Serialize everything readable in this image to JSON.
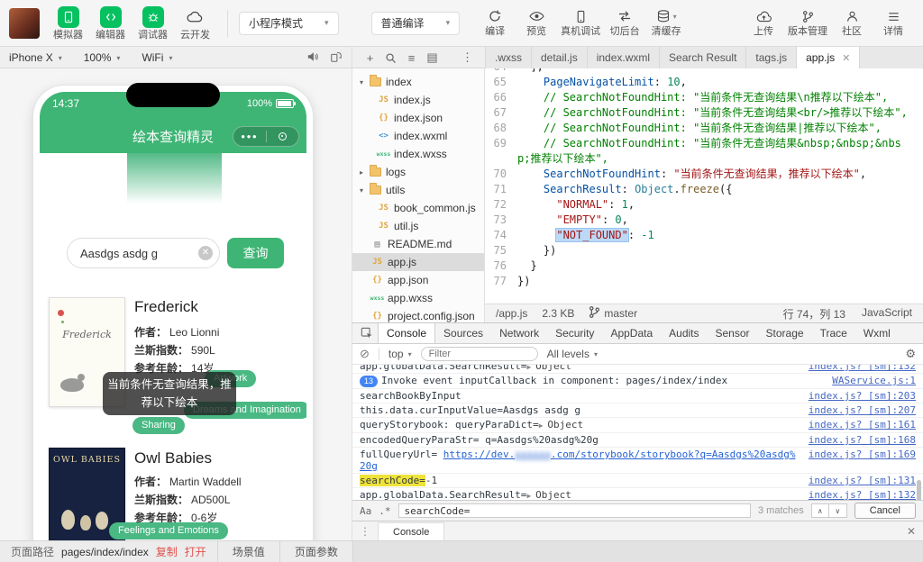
{
  "toolbar": {
    "panel_toggles": [
      {
        "id": "simulator",
        "label": "模拟器",
        "icon": "simulator-icon"
      },
      {
        "id": "editor",
        "label": "编辑器",
        "icon": "code-editor-icon"
      },
      {
        "id": "debugger",
        "label": "调试器",
        "icon": "debugger-icon"
      },
      {
        "id": "cloud-dev",
        "label": "云开发",
        "icon": "cloud-icon",
        "plain": true
      }
    ],
    "mode_select": "小程序模式",
    "compile_select": "普通编译",
    "actions": [
      {
        "id": "compile",
        "label": "编译",
        "icon": "compile-icon"
      },
      {
        "id": "preview",
        "label": "预览",
        "icon": "preview-eye-icon"
      },
      {
        "id": "real-device-debug",
        "label": "真机调试",
        "icon": "real-device-icon"
      },
      {
        "id": "switch-background",
        "label": "切后台",
        "icon": "switch-background-icon"
      },
      {
        "id": "clear-cache",
        "label": "清缓存",
        "icon": "clear-cache-icon",
        "caret": true
      }
    ],
    "right_actions": [
      {
        "id": "upload",
        "label": "上传",
        "icon": "upload-icon"
      },
      {
        "id": "version-manage",
        "label": "版本管理",
        "icon": "version-branch-icon"
      },
      {
        "id": "community",
        "label": "社区",
        "icon": "community-icon"
      },
      {
        "id": "details",
        "label": "详情",
        "icon": "details-menu-icon"
      }
    ]
  },
  "device_bar": {
    "device": "iPhone X",
    "zoom": "100%",
    "network": "WiFi",
    "icons": [
      "speaker-icon",
      "rotate-device-icon"
    ]
  },
  "tree_tools": {
    "icons": [
      "new-file-icon",
      "search-icon",
      "file-list-icon",
      "split-view-icon",
      "more-icon"
    ],
    "glyphs": [
      "+",
      "",
      "≡",
      "▤",
      "⋮"
    ]
  },
  "simulator": {
    "status_time": "14:37",
    "battery": "100%",
    "nav_title": "绘本查询精灵",
    "search_value": "Aasdgs asdg g",
    "search_button": "查询",
    "toast": "当前条件无查询结果，推荐以下绘本",
    "books": [
      {
        "title": "Frederick",
        "cover_text": "Frederick",
        "fields": [
          {
            "label": "作者：",
            "value": "Leo Lionni"
          },
          {
            "label": "兰斯指数：",
            "value": "590L"
          },
          {
            "label": "参考年龄：",
            "value": "14岁"
          }
        ],
        "tags": [
          "Artwork",
          "Dreams and Imagination",
          "Sharing"
        ]
      },
      {
        "title": "Owl Babies",
        "cover_text": "OWL BABIES",
        "fields": [
          {
            "label": "作者：",
            "value": "Martin Waddell"
          },
          {
            "label": "兰斯指数：",
            "value": "AD500L"
          },
          {
            "label": "参考年龄：",
            "value": "0-6岁"
          }
        ],
        "tags": [
          "Feelings and Emotions"
        ]
      }
    ]
  },
  "file_tree": {
    "items": [
      {
        "label": "index",
        "type": "folder",
        "expanded": true,
        "depth": 0
      },
      {
        "label": "index.js",
        "type": "js",
        "depth": 1
      },
      {
        "label": "index.json",
        "type": "json",
        "depth": 1
      },
      {
        "label": "index.wxml",
        "type": "wxml",
        "depth": 1
      },
      {
        "label": "index.wxss",
        "type": "wxss",
        "depth": 1
      },
      {
        "label": "logs",
        "type": "folder",
        "expanded": false,
        "depth": 0
      },
      {
        "label": "utils",
        "type": "folder",
        "expanded": true,
        "depth": 0
      },
      {
        "label": "book_common.js",
        "type": "js",
        "depth": 1
      },
      {
        "label": "util.js",
        "type": "js",
        "depth": 1
      },
      {
        "label": "README.md",
        "type": "md",
        "depth": 0
      },
      {
        "label": "app.js",
        "type": "js",
        "depth": 0,
        "selected": true
      },
      {
        "label": "app.json",
        "type": "json",
        "depth": 0
      },
      {
        "label": "app.wxss",
        "type": "wxss",
        "depth": 0
      },
      {
        "label": "project.config.json",
        "type": "json",
        "depth": 0
      }
    ]
  },
  "editor": {
    "tabs": [
      {
        "label": ".wxss"
      },
      {
        "label": "detail.js"
      },
      {
        "label": "index.wxml"
      },
      {
        "label": "Search Result"
      },
      {
        "label": "tags.js"
      },
      {
        "label": "app.js",
        "active": true,
        "closable": true
      }
    ],
    "lines": [
      {
        "n": "64",
        "segs": [
          {
            "t": "  ],"
          }
        ]
      },
      {
        "n": "65",
        "segs": [
          {
            "t": "    "
          },
          {
            "t": "PageNavigateLimit",
            "c": "prop"
          },
          {
            "t": ": "
          },
          {
            "t": "10",
            "c": "num"
          },
          {
            "t": ","
          }
        ]
      },
      {
        "n": "66",
        "segs": [
          {
            "t": "    "
          },
          {
            "t": "// SearchNotFoundHint: \"当前条件无查询结果\\n推荐以下绘本\",",
            "c": "com"
          }
        ]
      },
      {
        "n": "67",
        "segs": [
          {
            "t": "    "
          },
          {
            "t": "// SearchNotFoundHint: \"当前条件无查询结果<br/>推荐以下绘本\",",
            "c": "com"
          }
        ]
      },
      {
        "n": "68",
        "segs": [
          {
            "t": "    "
          },
          {
            "t": "// SearchNotFoundHint: \"当前条件无查询结果|推荐以下绘本\",",
            "c": "com"
          }
        ]
      },
      {
        "n": "69",
        "segs": [
          {
            "t": "    "
          },
          {
            "t": "// SearchNotFoundHint: \"当前条件无查询结果&nbsp;&nbsp;&nbsp;推荐以下绘本\",",
            "c": "com"
          }
        ]
      },
      {
        "n": "70",
        "segs": [
          {
            "t": "    "
          },
          {
            "t": "SearchNotFoundHint",
            "c": "prop"
          },
          {
            "t": ": "
          },
          {
            "t": "\"当前条件无查询结果，推荐以下绘本\"",
            "c": "str"
          },
          {
            "t": ","
          }
        ]
      },
      {
        "n": "71",
        "segs": [
          {
            "t": "    "
          },
          {
            "t": "SearchResult",
            "c": "prop"
          },
          {
            "t": ": "
          },
          {
            "t": "Object",
            "c": "cls"
          },
          {
            "t": "."
          },
          {
            "t": "freeze",
            "c": "meth"
          },
          {
            "t": "({"
          }
        ]
      },
      {
        "n": "72",
        "segs": [
          {
            "t": "      "
          },
          {
            "t": "\"NORMAL\"",
            "c": "str"
          },
          {
            "t": ": "
          },
          {
            "t": "1",
            "c": "num"
          },
          {
            "t": ","
          }
        ]
      },
      {
        "n": "73",
        "segs": [
          {
            "t": "      "
          },
          {
            "t": "\"EMPTY\"",
            "c": "str"
          },
          {
            "t": ": "
          },
          {
            "t": "0",
            "c": "num"
          },
          {
            "t": ","
          }
        ]
      },
      {
        "n": "74",
        "segs": [
          {
            "t": "      "
          },
          {
            "t": "\"NOT_FOUND\"",
            "c": "str sel"
          },
          {
            "t": ": "
          },
          {
            "t": "-1",
            "c": "num"
          }
        ]
      },
      {
        "n": "75",
        "segs": [
          {
            "t": "    })"
          }
        ]
      },
      {
        "n": "76",
        "segs": [
          {
            "t": "  }"
          }
        ]
      },
      {
        "n": "77",
        "segs": [
          {
            "t": "})"
          }
        ]
      }
    ],
    "status_left": {
      "file": "/app.js",
      "size": "2.3 KB",
      "branch": "master"
    },
    "status_right": {
      "cursor": "行 74，列 13",
      "language": "JavaScript"
    }
  },
  "devtools": {
    "tabs": [
      {
        "label": "Console",
        "active": true
      },
      {
        "label": "Sources"
      },
      {
        "label": "Network"
      },
      {
        "label": "Security"
      },
      {
        "label": "AppData"
      },
      {
        "label": "Audits"
      },
      {
        "label": "Sensor"
      },
      {
        "label": "Storage"
      },
      {
        "label": "Trace"
      },
      {
        "label": "Wxml"
      }
    ],
    "filter_bar": {
      "context": "top",
      "filter_placeholder": "Filter",
      "levels": "All levels"
    },
    "rows": [
      {
        "clipped": true,
        "parts": [
          {
            "t": "app.globalData.SearchResult="
          },
          {
            "t": "▶ ",
            "c": "arrow"
          },
          {
            "t": "Object",
            "c": "obj"
          }
        ],
        "link": "index.js? [sm]:132"
      },
      {
        "badge": "13",
        "parts": [
          {
            "t": "Invoke event inputCallback in component: pages/index/index"
          }
        ],
        "link": "WAService.js:1"
      },
      {
        "parts": [
          {
            "t": "searchBookByInput"
          }
        ],
        "link": "index.js? [sm]:203"
      },
      {
        "parts": [
          {
            "t": "this.data.curInputValue=Aasdgs asdg g"
          }
        ],
        "link": "index.js? [sm]:207"
      },
      {
        "parts": [
          {
            "t": "queryStorybook: queryParaDict="
          },
          {
            "t": "▶ ",
            "c": "arrow"
          },
          {
            "t": "Object",
            "c": "obj"
          }
        ],
        "link": "index.js? [sm]:161"
      },
      {
        "parts": [
          {
            "t": "encodedQueryParaStr= q=Aasdgs%20asdg%20g"
          }
        ],
        "link": "index.js? [sm]:168"
      },
      {
        "parts": [
          {
            "t": "fullQueryUrl= "
          },
          {
            "t": "https://dev.",
            "c": "url"
          },
          {
            "t": "xxxxxx",
            "c": "url redact"
          },
          {
            "t": ".com/storybook/storybook?q=Aasdgs%20asdg%20g",
            "c": "url"
          }
        ],
        "link": "index.js? [sm]:169"
      },
      {
        "parts": [
          {
            "t": "searchCode=",
            "c": "hl"
          },
          {
            "t": "-1"
          }
        ],
        "link": "index.js? [sm]:131"
      },
      {
        "parts": [
          {
            "t": "app.globalData.SearchResult="
          },
          {
            "t": "▶ ",
            "c": "arrow"
          },
          {
            "t": "Object",
            "c": "obj"
          }
        ],
        "link": "index.js? [sm]:132"
      },
      {
        "prompt": true
      }
    ],
    "search_bar": {
      "case_toggle": "Aa",
      "regex_toggle": ".*",
      "value": "searchCode=",
      "matches": "3 matches",
      "up": "∧",
      "down": "∨",
      "cancel": "Cancel"
    },
    "drawer": {
      "label": "Console",
      "close": "✕"
    }
  },
  "status_bar": {
    "page_path_label": "页面路径",
    "page_path": "pages/index/index",
    "copy_link": "复制",
    "open_link": "打开",
    "scene_label": "场景值",
    "params_label": "页面参数"
  },
  "colors": {
    "brand_green": "#07c160",
    "mini_nav_green": "#3eb575",
    "tag_green": "#49b883",
    "console_highlight": "#efe33a",
    "link_blue": "#4568c4"
  }
}
